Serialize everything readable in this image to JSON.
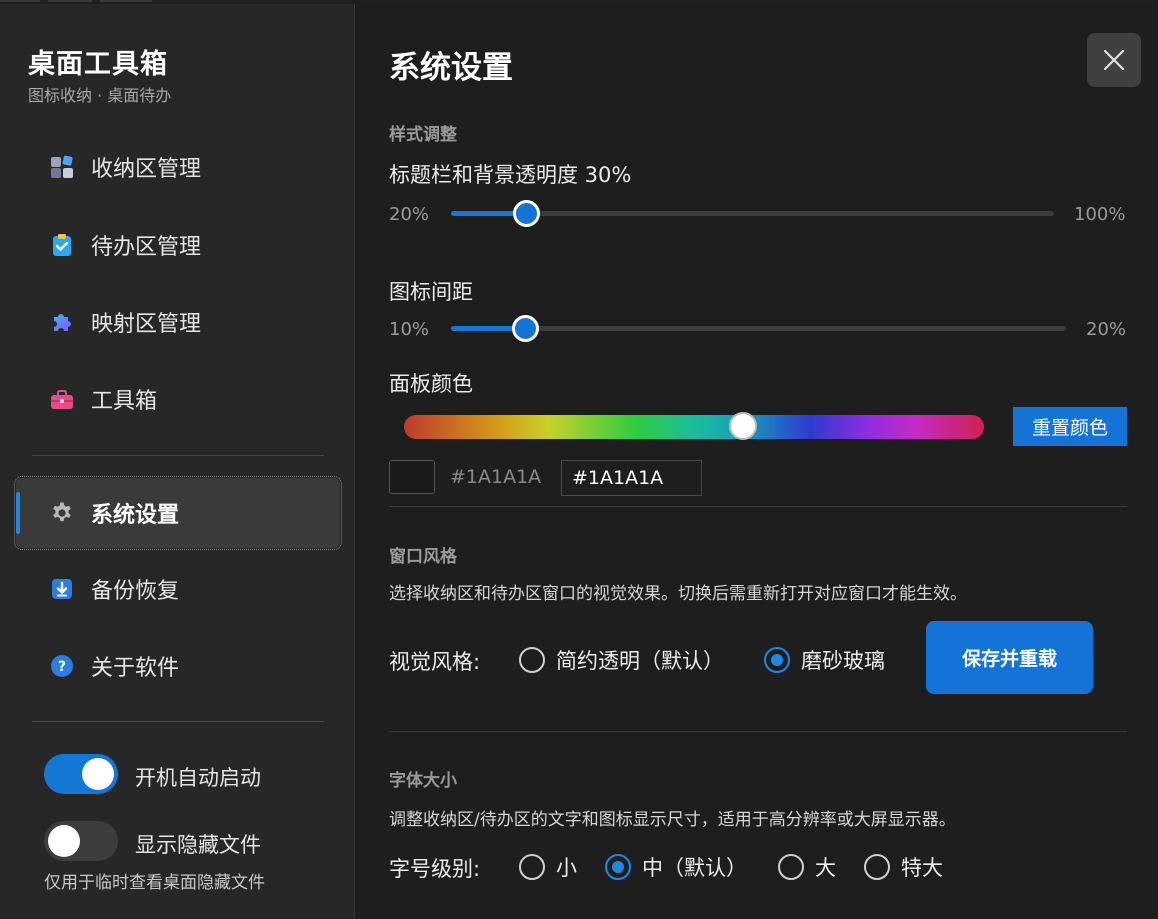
{
  "sidebar": {
    "title": "桌面工具箱",
    "subtitle": "图标收纳 · 桌面待办",
    "items": [
      {
        "label": "收纳区管理",
        "icon": "grid-blocks-icon"
      },
      {
        "label": "待办区管理",
        "icon": "clipboard-check-icon"
      },
      {
        "label": "映射区管理",
        "icon": "puzzle-icon"
      },
      {
        "label": "工具箱",
        "icon": "toolbox-icon"
      },
      {
        "label": "系统设置",
        "icon": "gear-icon",
        "active": true
      },
      {
        "label": "备份恢复",
        "icon": "download-icon"
      },
      {
        "label": "关于软件",
        "icon": "help-icon"
      }
    ],
    "toggles": [
      {
        "label": "开机自动启动",
        "on": true
      },
      {
        "label": "显示隐藏文件",
        "on": false
      }
    ],
    "hint": "仅用于临时查看桌面隐藏文件"
  },
  "main": {
    "title": "系统设置",
    "style_section": "样式调整",
    "opacity": {
      "label": "标题栏和背景透明度 30%",
      "min_label": "20%",
      "max_label": "100%",
      "min": 20,
      "max": 100,
      "value": 30
    },
    "spacing": {
      "label": "图标间距",
      "min_label": "10%",
      "max_label": "20%",
      "min": 10,
      "max": 20,
      "value": 11.2
    },
    "panel_color": {
      "label": "面板颜色",
      "reset_label": "重置颜色",
      "hex_text": "#1A1A1A",
      "hex_value": "#1A1A1A",
      "swatch": "#1A1A1A"
    },
    "window_style": {
      "section": "窗口风格",
      "desc": "选择收纳区和待办区窗口的视觉效果。切换后需重新打开对应窗口才能生效。",
      "label": "视觉风格:",
      "options": [
        {
          "label": "简约透明（默认）",
          "checked": false
        },
        {
          "label": "磨砂玻璃",
          "checked": true
        }
      ],
      "save_label": "保存并重载"
    },
    "font_size": {
      "section": "字体大小",
      "desc": "调整收纳区/待办区的文字和图标显示尺寸，适用于高分辨率或大屏显示器。",
      "label": "字号级别:",
      "options": [
        {
          "label": "小",
          "checked": false
        },
        {
          "label": "中（默认）",
          "checked": true
        },
        {
          "label": "大",
          "checked": false
        },
        {
          "label": "特大",
          "checked": false
        }
      ]
    }
  },
  "colors": {
    "accent": "#1473d6",
    "sidebar_bg": "#272727",
    "main_bg": "#1e1e1e"
  }
}
